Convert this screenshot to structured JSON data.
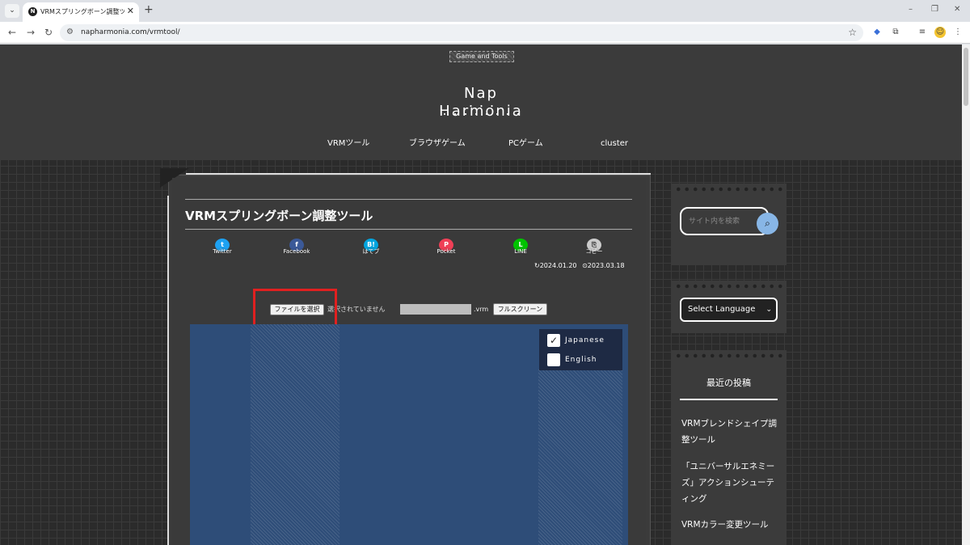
{
  "browser": {
    "tab_title": "VRMスプリングボーン調整ツール | N",
    "favicon_letter": "N",
    "new_tab": "+",
    "close_tab": "✕",
    "minimize": "–",
    "maximize": "❐",
    "close_window": "✕",
    "url": "napharmonia.com/vrmtool/"
  },
  "site": {
    "tagline": "Game and Tools",
    "title": "Nap Harmonia",
    "title_dots": "・・・ ・・・・・・・・",
    "nav": [
      "VRMツール",
      "ブラウザゲーム",
      "PCゲーム",
      "cluster"
    ]
  },
  "article": {
    "title": "VRMスプリングボーン調整ツール",
    "share": [
      {
        "label": "Twitter",
        "glyph": "t",
        "color": "#1da1f2"
      },
      {
        "label": "Facebook",
        "glyph": "f",
        "color": "#3b5998"
      },
      {
        "label": "はてブ",
        "glyph": "B!",
        "color": "#00a4de"
      },
      {
        "label": "Pocket",
        "glyph": "P",
        "color": "#ef3f56"
      },
      {
        "label": "LINE",
        "glyph": "L",
        "color": "#00c300"
      },
      {
        "label": "コピー",
        "glyph": "⎘",
        "color": "#cccccc"
      }
    ],
    "updated": "↻2024.01.20",
    "published": "⊙2023.03.18"
  },
  "tool": {
    "file_button": "ファイルを選択",
    "file_status": "選択されていません",
    "name_value": "",
    "extension": ".vrm",
    "fullscreen_button": "フルスクリーン",
    "languages": [
      {
        "label": "Japanese",
        "checked": true
      },
      {
        "label": "English",
        "checked": false
      }
    ]
  },
  "sidebar": {
    "search_placeholder": "サイト内を検索",
    "language_select": "Select Language",
    "recent_heading": "最近の投稿",
    "recent_posts": [
      "VRMブレンドシェイプ調整ツール",
      "「ユニバーサルエネミーズ」アクションシューティング",
      "VRMカラー変更ツール"
    ]
  }
}
